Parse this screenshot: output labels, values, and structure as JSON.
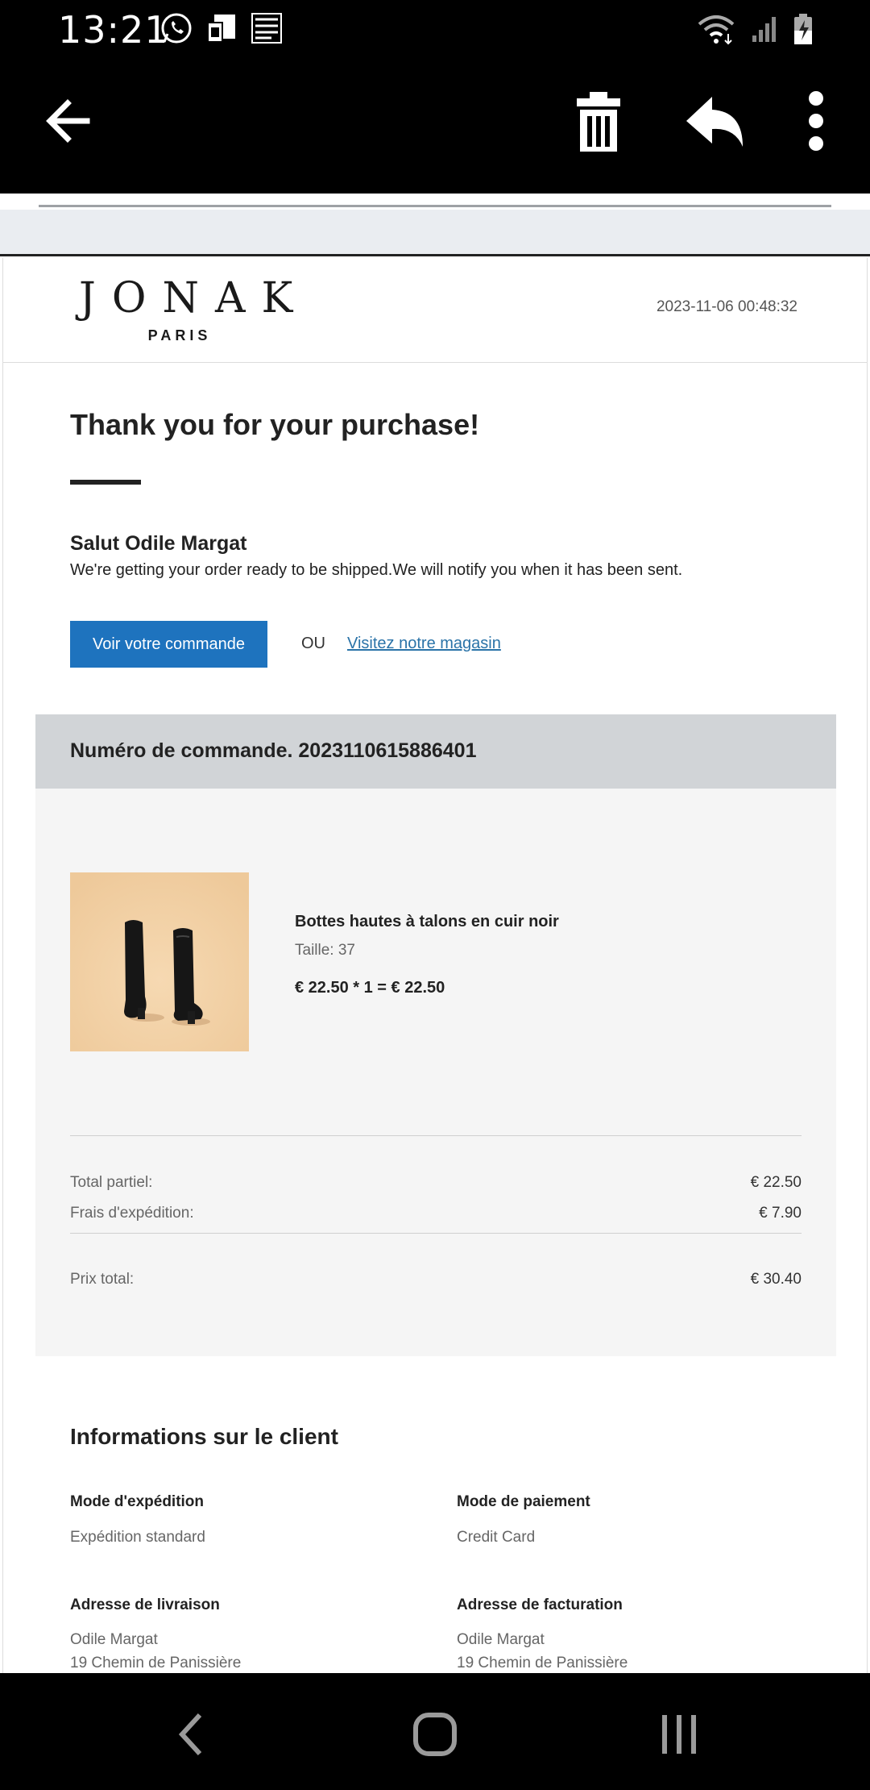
{
  "status_bar": {
    "time": "13:21",
    "icons_left": [
      "whatsapp-icon",
      "sim-card-icon",
      "newspaper-icon"
    ],
    "icons_right": [
      "wifi-icon",
      "signal-icon",
      "battery-charging-icon"
    ]
  },
  "app_bar": {
    "icons": [
      "back-arrow-icon",
      "delete-icon",
      "reply-icon",
      "more-options-icon"
    ]
  },
  "email": {
    "brand": {
      "name": "JONAK",
      "subtitle": "PARIS"
    },
    "date": "2023-11-06 00:48:32",
    "heading": "Thank you for your purchase!",
    "greeting": "Salut Odile Margat",
    "message": "We're getting your order ready to be shipped.We will notify you when it has been sent.",
    "view_order_button": "Voir votre commande",
    "or_text": "OU",
    "store_link": "Visitez notre magasin",
    "order": {
      "number_label": "Numéro de commande. 2023110615886401",
      "item": {
        "name": "Bottes hautes à talons en cuir noir",
        "size": "Taille: 37",
        "price": "€ 22.50 * 1 = € 22.50"
      },
      "subtotal_label": "Total partiel:",
      "subtotal_value": "€ 22.50",
      "shipping_label": "Frais d'expédition:",
      "shipping_value": "€ 7.90",
      "total_label": "Prix total:",
      "total_value": "€ 30.40"
    },
    "customer": {
      "title": "Informations sur le client",
      "shipping_method_label": "Mode d'expédition",
      "shipping_method_value": "Expédition standard",
      "payment_method_label": "Mode de paiement",
      "payment_method_value": "Credit Card",
      "delivery_address_label": "Adresse de livraison",
      "delivery_name": "Odile Margat",
      "delivery_street": "19 Chemin de Panissière",
      "billing_address_label": "Adresse de facturation",
      "billing_name": "Odile Margat",
      "billing_street": "19 Chemin de Panissière"
    }
  },
  "nav_bar": {
    "icons": [
      "nav-back-icon",
      "home-icon",
      "recent-apps-icon"
    ]
  }
}
